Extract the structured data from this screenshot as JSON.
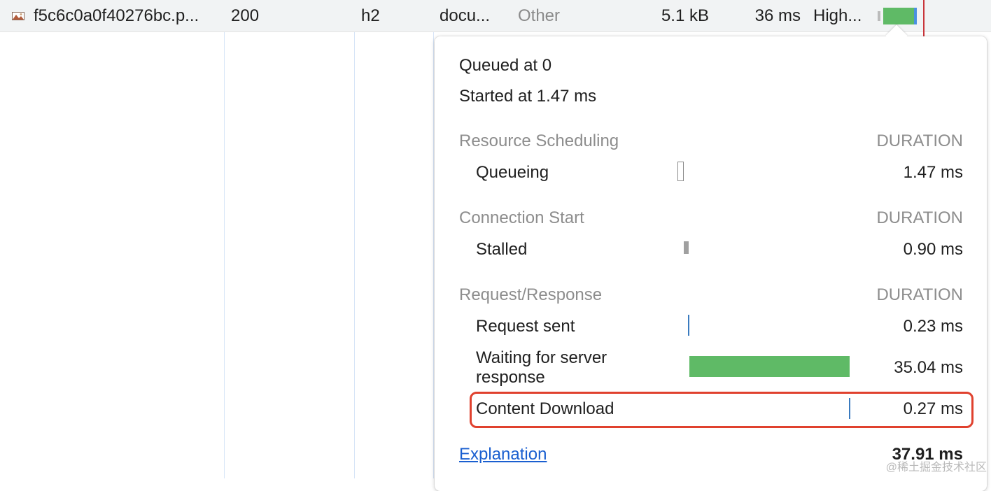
{
  "request_row": {
    "name": "f5c6c0a0f40276bc.p...",
    "status": "200",
    "protocol": "h2",
    "type": "docu...",
    "initiator": "Other",
    "size": "5.1 kB",
    "time": "36 ms",
    "priority": "High..."
  },
  "timing": {
    "queued_at": "Queued at 0",
    "started_at": "Started at 1.47 ms",
    "duration_header": "DURATION",
    "sections": {
      "scheduling": {
        "title": "Resource Scheduling",
        "queueing": {
          "label": "Queueing",
          "value": "1.47 ms"
        }
      },
      "connection": {
        "title": "Connection Start",
        "stalled": {
          "label": "Stalled",
          "value": "0.90 ms"
        }
      },
      "request_response": {
        "title": "Request/Response",
        "request_sent": {
          "label": "Request sent",
          "value": "0.23 ms"
        },
        "waiting_line1": "Waiting for server",
        "waiting_line2": "response",
        "waiting_value": "35.04 ms",
        "content_download": {
          "label": "Content Download",
          "value": "0.27 ms"
        }
      }
    },
    "explanation_link": "Explanation",
    "total": "37.91 ms"
  },
  "colors": {
    "waiting_bar": "#5fba66",
    "highlight_border": "#e0412e",
    "link": "#1a5fd0"
  },
  "watermark": "@稀土掘金技术社区"
}
